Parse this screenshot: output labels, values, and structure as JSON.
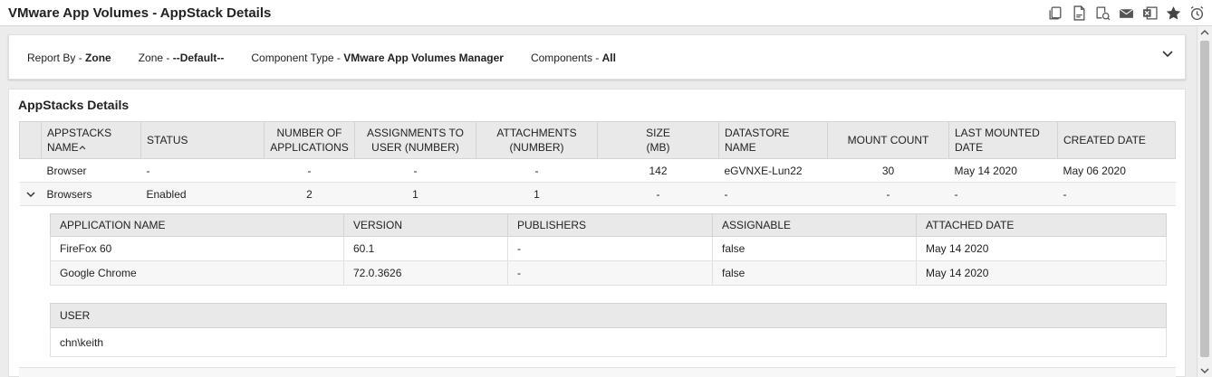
{
  "window": {
    "title": "VMware App Volumes - AppStack Details"
  },
  "toolbar": {
    "icons": [
      "copy-icon",
      "pdf-icon",
      "print-preview-icon",
      "mail-icon",
      "excel-icon",
      "star-icon",
      "alarm-clock-icon"
    ]
  },
  "filters": {
    "report_by_label": "Report By - ",
    "report_by_value": "Zone",
    "zone_label": "Zone - ",
    "zone_value": "--Default--",
    "component_type_label": "Component Type - ",
    "component_type_value": "VMware App Volumes Manager",
    "components_label": "Components - ",
    "components_value": "All"
  },
  "section": {
    "title": "AppStacks Details"
  },
  "main_table": {
    "headers": {
      "name_line1": "APPSTACKS",
      "name_line2": "NAME",
      "status": "STATUS",
      "apps_line1": "NUMBER OF",
      "apps_line2": "APPLICATIONS",
      "assign_line1": "ASSIGNMENTS TO",
      "assign_line2": "USER (NUMBER)",
      "attach_line1": "ATTACHMENTS",
      "attach_line2": "(NUMBER)",
      "size_line1": "SIZE",
      "size_line2": "(MB)",
      "ds_line1": "DATASTORE",
      "ds_line2": "NAME",
      "mount": "MOUNT COUNT",
      "last_line1": "LAST MOUNTED",
      "last_line2": "DATE",
      "created": "CREATED DATE"
    },
    "rows": [
      {
        "name": "Browser",
        "status": "-",
        "apps": "-",
        "assign": "-",
        "attach": "-",
        "size": "142",
        "datastore": "eGVNXE-Lun22",
        "mount": "30",
        "last": "May 14 2020",
        "created": "May 06 2020"
      },
      {
        "name": "Browsers",
        "status": "Enabled",
        "apps": "2",
        "assign": "1",
        "attach": "1",
        "size": "-",
        "datastore": "-",
        "mount": "-",
        "last": "-",
        "created": "-"
      }
    ]
  },
  "apps_table": {
    "headers": {
      "name": "APPLICATION NAME",
      "version": "VERSION",
      "publishers": "PUBLISHERS",
      "assignable": "ASSIGNABLE",
      "attached": "ATTACHED DATE"
    },
    "rows": [
      {
        "name": "FireFox 60",
        "version": "60.1",
        "publishers": "-",
        "assignable": "false",
        "attached": "May 14 2020"
      },
      {
        "name": "Google Chrome",
        "version": "72.0.3626",
        "publishers": "-",
        "assignable": "false",
        "attached": "May 14 2020"
      }
    ]
  },
  "user_table": {
    "header": "USER",
    "rows": [
      {
        "user": "chn\\keith"
      }
    ]
  }
}
